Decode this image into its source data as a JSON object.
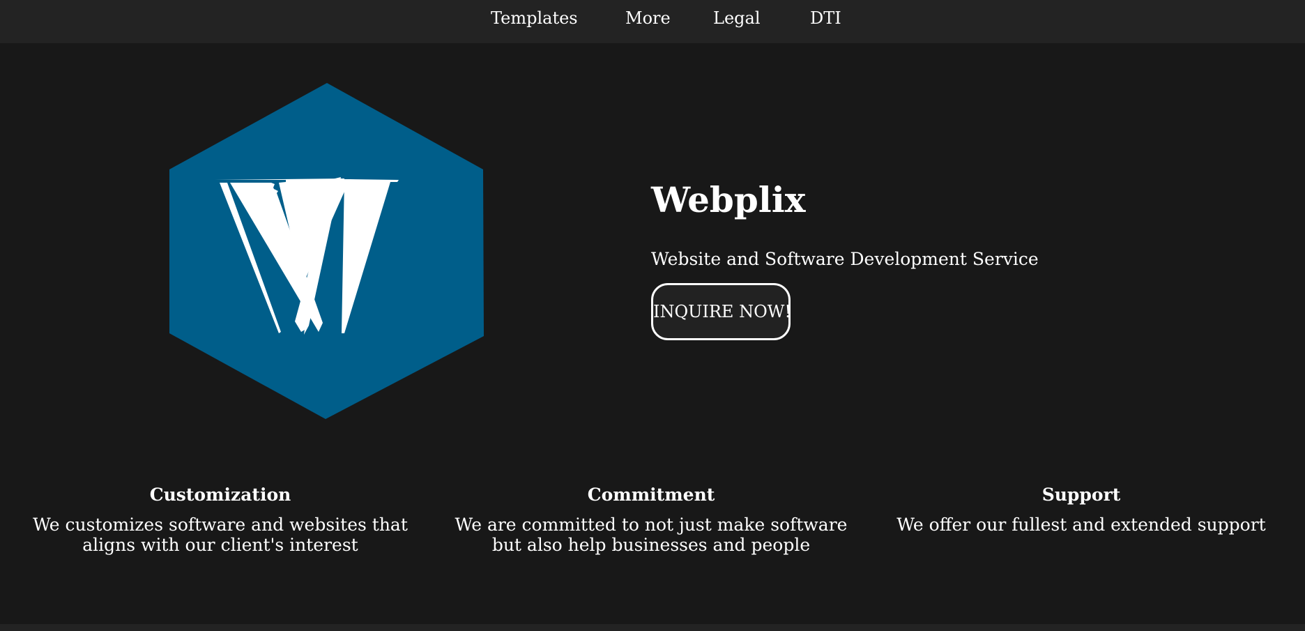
{
  "nav": {
    "items": [
      {
        "label": "Templates"
      },
      {
        "label": "More"
      },
      {
        "label": "Legal"
      },
      {
        "label": "DTI"
      }
    ]
  },
  "logo": {
    "icon": "webplix-hexagon-w-logo",
    "letter": "W",
    "color": "#005e8a"
  },
  "hero": {
    "title": "Webplix",
    "subtitle": "Website and Software Development Service",
    "button_label": "INQUIRE NOW!"
  },
  "features": [
    {
      "title": "Customization",
      "text": "We customizes software and websites that aligns with our client's interest"
    },
    {
      "title": "Commitment",
      "text": "We are committed to not just make software but also help businesses and people"
    },
    {
      "title": "Support",
      "text": "We offer our fullest and extended support"
    }
  ],
  "colors": {
    "background": "#181818",
    "nav_background": "#232323",
    "accent": "#005e8a",
    "text": "#ffffff"
  }
}
